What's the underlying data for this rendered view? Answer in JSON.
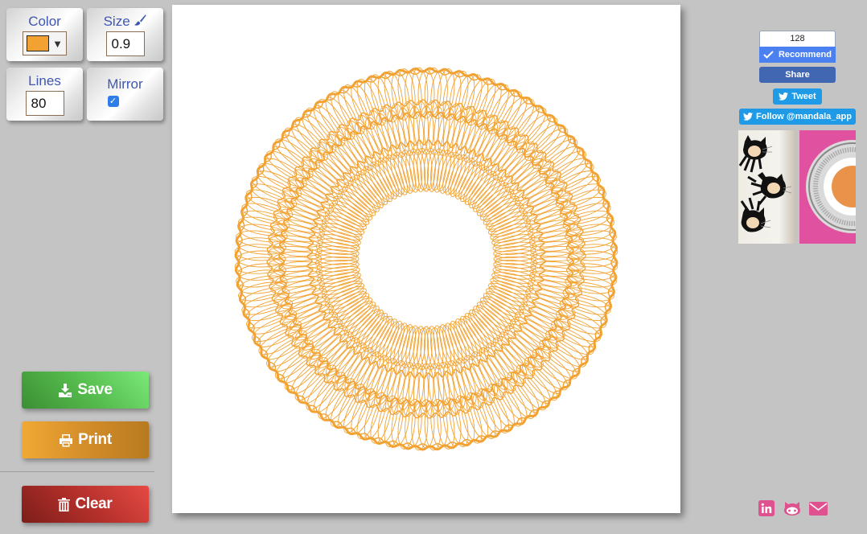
{
  "controls": {
    "color": {
      "label": "Color",
      "value": "#f2a232",
      "icon": "caret-down-icon"
    },
    "size": {
      "label": "Size",
      "value": "0.9",
      "icon": "paintbrush-icon"
    },
    "lines": {
      "label": "Lines",
      "value": "80"
    },
    "mirror": {
      "label": "Mirror",
      "checked": true,
      "check_glyph": "✓"
    }
  },
  "actions": {
    "save": {
      "label": "Save",
      "icon": "download-icon"
    },
    "print": {
      "label": "Print",
      "icon": "printer-icon"
    },
    "clear": {
      "label": "Clear",
      "icon": "trash-icon"
    }
  },
  "canvas": {
    "stroke_color": "#f2a232",
    "background": "#ffffff"
  },
  "social": {
    "facebook": {
      "count": "128",
      "recommend_label": "Recommend",
      "share_label": "Share"
    },
    "twitter": {
      "tweet_label": "Tweet",
      "follow_label": "Follow @mandala_app"
    },
    "thumbnails": [
      {
        "name": "octocat-thumbnail"
      },
      {
        "name": "mandala-thumbnail"
      }
    ],
    "footer_icons": [
      "linkedin-icon",
      "github-icon",
      "email-icon"
    ],
    "accent": "#e0528f"
  }
}
